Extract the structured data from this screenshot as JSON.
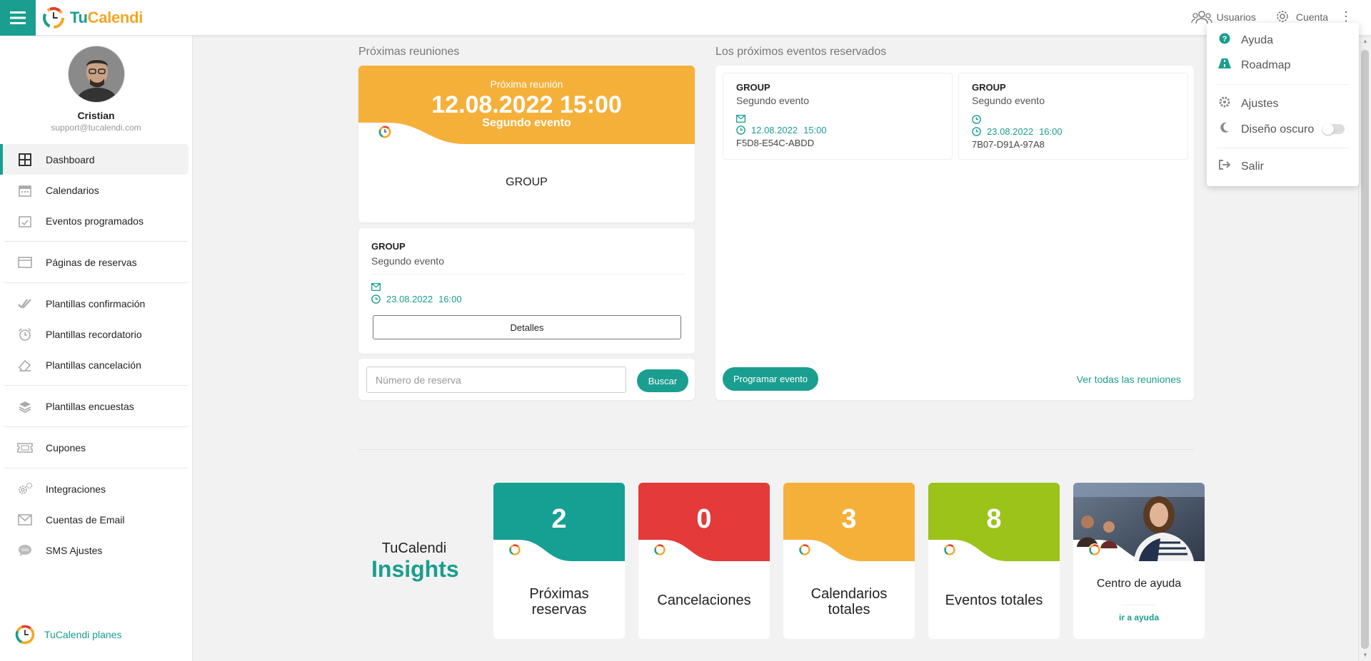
{
  "app": {
    "brand_part1": "Tu",
    "brand_part2": "Calendi",
    "accent": "#1a9e8f",
    "orange": "#f5b03a"
  },
  "topbar": {
    "users_label": "Usuarios",
    "account_label": "Cuenta"
  },
  "dropdown": {
    "items": [
      {
        "label": "Ayuda",
        "icon": "help-circle-icon"
      },
      {
        "label": "Roadmap",
        "icon": "road-icon"
      },
      {
        "label": "Ajustes",
        "icon": "gear-icon"
      },
      {
        "label": "Diseño oscuro",
        "icon": "moon-icon"
      },
      {
        "label": "Salir",
        "icon": "logout-icon"
      }
    ],
    "dark_mode": false
  },
  "profile": {
    "name": "Cristian",
    "email": "support@tucalendi.com"
  },
  "sidebar": {
    "items": [
      {
        "label": "Dashboard",
        "icon": "dashboard-icon"
      },
      {
        "label": "Calendarios",
        "icon": "calendar-icon"
      },
      {
        "label": "Eventos programados",
        "icon": "calendar-check-icon"
      },
      {
        "label": "Páginas de reservas",
        "icon": "browser-window-icon"
      },
      {
        "label": "Plantillas confirmación",
        "icon": "double-check-icon"
      },
      {
        "label": "Plantillas recordatorio",
        "icon": "alarm-clock-icon"
      },
      {
        "label": "Plantillas cancelación",
        "icon": "eraser-icon"
      },
      {
        "label": "Plantillas encuestas",
        "icon": "layers-icon"
      },
      {
        "label": "Cupones",
        "icon": "ticket-icon"
      },
      {
        "label": "Integraciones",
        "icon": "gears-icon"
      },
      {
        "label": "Cuentas de Email",
        "icon": "envelope-icon"
      },
      {
        "label": "SMS Ajustes",
        "icon": "sms-bubble-icon"
      }
    ],
    "plans_label": "TuCalendi planes"
  },
  "next_meetings": {
    "section_title": "Próximas reuniones",
    "featured": {
      "label": "Próxima reunión",
      "datetime": "12.08.2022 15:00",
      "event": "Segundo evento",
      "group": "GROUP"
    },
    "list": [
      {
        "group": "GROUP",
        "event": "Segundo evento",
        "date": "23.08.2022",
        "time": "16:00",
        "button": "Detalles"
      }
    ],
    "search_placeholder": "Número de reserva",
    "search_button": "Buscar"
  },
  "upcoming": {
    "section_title": "Los próximos eventos reservados",
    "cards": [
      {
        "group": "GROUP",
        "event": "Segundo evento",
        "date": "12.08.2022",
        "time": "15:00",
        "code": "F5D8-E54C-ABDD"
      },
      {
        "group": "GROUP",
        "event": "Segundo evento",
        "date": "23.08.2022",
        "time": "16:00",
        "code": "7B07-D91A-97A8"
      }
    ],
    "program_button": "Programar evento",
    "view_all_link": "Ver todas las reuniones"
  },
  "insights": {
    "title_top": "TuCalendi",
    "title_bottom": "Insights",
    "stats": [
      {
        "value": "2",
        "label": "Próximas reservas",
        "color": "#16a093"
      },
      {
        "value": "0",
        "label": "Cancelaciones",
        "color": "#e43a3a"
      },
      {
        "value": "3",
        "label": "Calendarios totales",
        "color": "#f5b03a"
      },
      {
        "value": "8",
        "label": "Eventos totales",
        "color": "#9bc31a"
      }
    ],
    "help": {
      "title": "Centro de ayuda",
      "link": "ir a ayuda"
    }
  }
}
